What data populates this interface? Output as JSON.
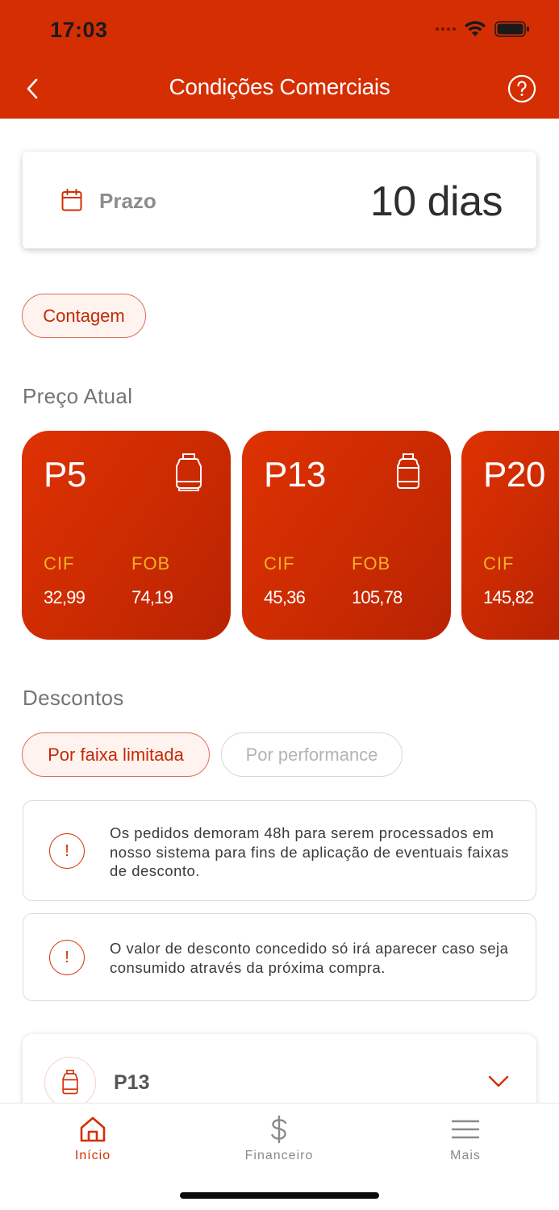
{
  "status_bar": {
    "time": "17:03"
  },
  "header": {
    "title": "Condições Comerciais",
    "back_icon": "chevron-left-icon",
    "help_icon": "help-circle-icon"
  },
  "prazo": {
    "label": "Prazo",
    "value": "10 dias",
    "icon": "calendar-icon"
  },
  "location_chip": {
    "label": "Contagem"
  },
  "preco_atual": {
    "title": "Preço Atual",
    "cif_label": "CIF",
    "fob_label": "FOB",
    "cards": [
      {
        "name": "P5",
        "cif": "32,99",
        "fob": "74,19"
      },
      {
        "name": "P13",
        "cif": "45,36",
        "fob": "105,78"
      },
      {
        "name": "P20",
        "cif": "145,82",
        "fob": ""
      }
    ]
  },
  "descontos": {
    "title": "Descontos",
    "tabs": [
      {
        "label": "Por faixa limitada",
        "active": true
      },
      {
        "label": "Por performance",
        "active": false
      }
    ],
    "notices": [
      {
        "text": "Os pedidos demoram 48h para serem processados em nosso sistema para fins de aplicação de eventuais faixas de desconto."
      },
      {
        "text": "O valor de desconto concedido só irá aparecer caso seja consumido através da próxima compra."
      }
    ],
    "accordion": {
      "title": "P13"
    }
  },
  "tabbar": {
    "items": [
      {
        "label": "Início",
        "icon": "home-icon",
        "active": true
      },
      {
        "label": "Financeiro",
        "icon": "dollar-icon",
        "active": false
      },
      {
        "label": "Mais",
        "icon": "menu-icon",
        "active": false
      }
    ]
  },
  "colors": {
    "brand": "#d52e02",
    "accent_gold": "#f3b21e",
    "inactive": "#8a8a8a"
  }
}
